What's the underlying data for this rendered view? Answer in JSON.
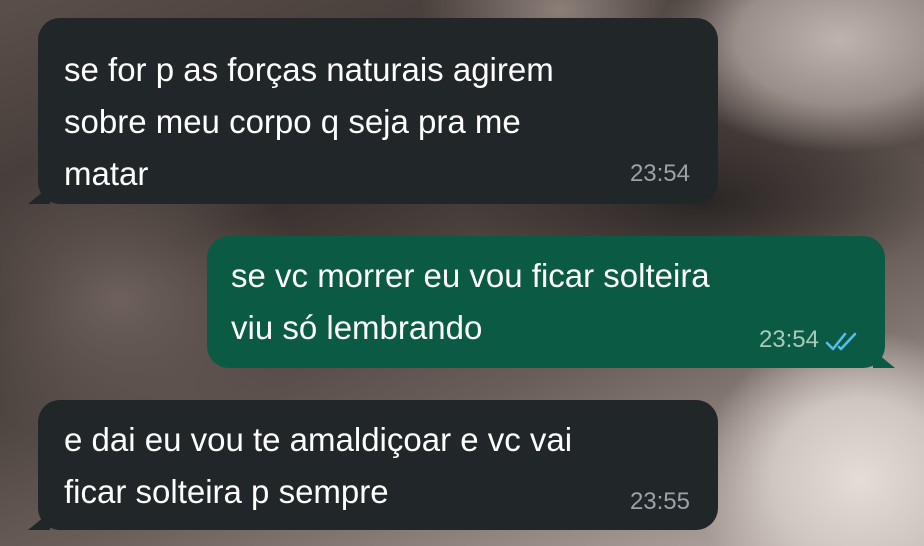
{
  "messages": [
    {
      "direction": "incoming",
      "text": "se for p as forças naturais agirem\nsobre meu corpo q seja pra me\nmatar",
      "time": "23:54"
    },
    {
      "direction": "outgoing",
      "text": "se vc morrer eu vou ficar solteira\nviu só lembrando",
      "time": "23:54",
      "status_icon": "double-check-read-icon",
      "status_color": "#53bdeb"
    },
    {
      "direction": "incoming",
      "text": "e dai eu vou te amaldiçoar e vc vai\nficar solteira p sempre",
      "time": "23:55"
    }
  ],
  "colors": {
    "incoming_bubble": "#212629",
    "outgoing_bubble": "#0b5a43",
    "text": "#ffffff"
  }
}
